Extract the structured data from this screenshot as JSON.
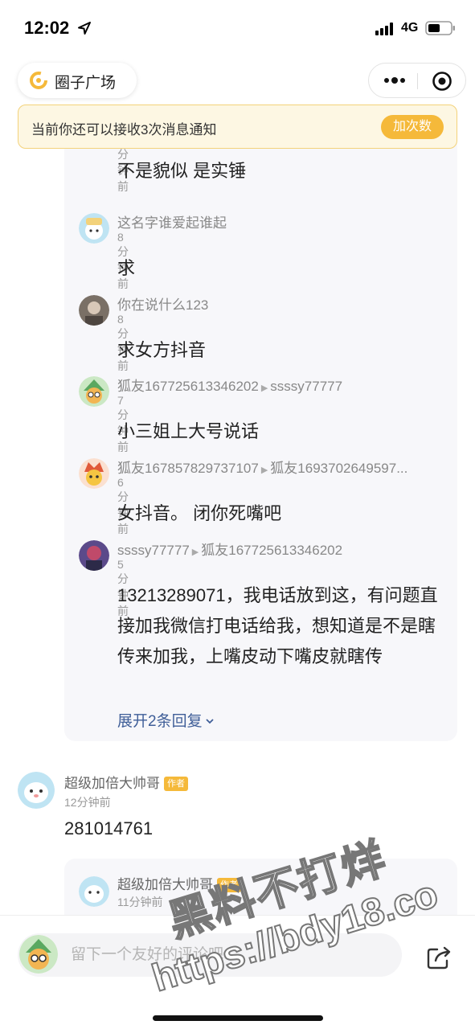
{
  "status_bar": {
    "time": "12:02",
    "network": "4G"
  },
  "header": {
    "circle_title": "圈子广场"
  },
  "notice": {
    "text": "当前你还可以接收3次消息通知",
    "button": "加次数"
  },
  "thread": {
    "replies": [
      {
        "names": "",
        "reply_to": "",
        "ago": "8分钟前",
        "body": "不是貌似 是实锤"
      },
      {
        "names": "这名字谁爱起谁起",
        "reply_to": "",
        "ago": "8分钟前",
        "body": "求"
      },
      {
        "names": "你在说什么123",
        "reply_to": "",
        "ago": "8分钟前",
        "body": "求女方抖音"
      },
      {
        "names": "狐友167725613346202",
        "reply_to": "ssssy77777",
        "ago": "7分钟前",
        "body": "小三姐上大号说话"
      },
      {
        "names": "狐友167857829737107",
        "reply_to": "狐友1693702649597...",
        "ago": "6分钟前",
        "body": "女抖音。 闭你死嘴吧"
      },
      {
        "names": "ssssy77777",
        "reply_to": "狐友167725613346202",
        "ago": "5分钟前",
        "body": "13213289071，我电话放到这，有问题直接加我微信打电话给我，想知道是不是瞎传来加我，上嘴皮动下嘴皮就瞎传"
      }
    ],
    "expand_label": "展开2条回复"
  },
  "comment": {
    "name": "超级加倍大帅哥",
    "badge": "作者",
    "ago": "12分钟前",
    "body": "281014761",
    "sub": {
      "name": "超级加倍大帅哥",
      "badge": "作者",
      "ago": "11分钟前"
    }
  },
  "bottom": {
    "placeholder": "留下一个友好的评论吧"
  },
  "watermark": {
    "line1": "黑料不打烊",
    "line2": "https://bdy18.co"
  },
  "colors": {
    "accent": "#f5b93a",
    "link": "#3f5e98",
    "notice_bg": "#fdf7e3"
  }
}
